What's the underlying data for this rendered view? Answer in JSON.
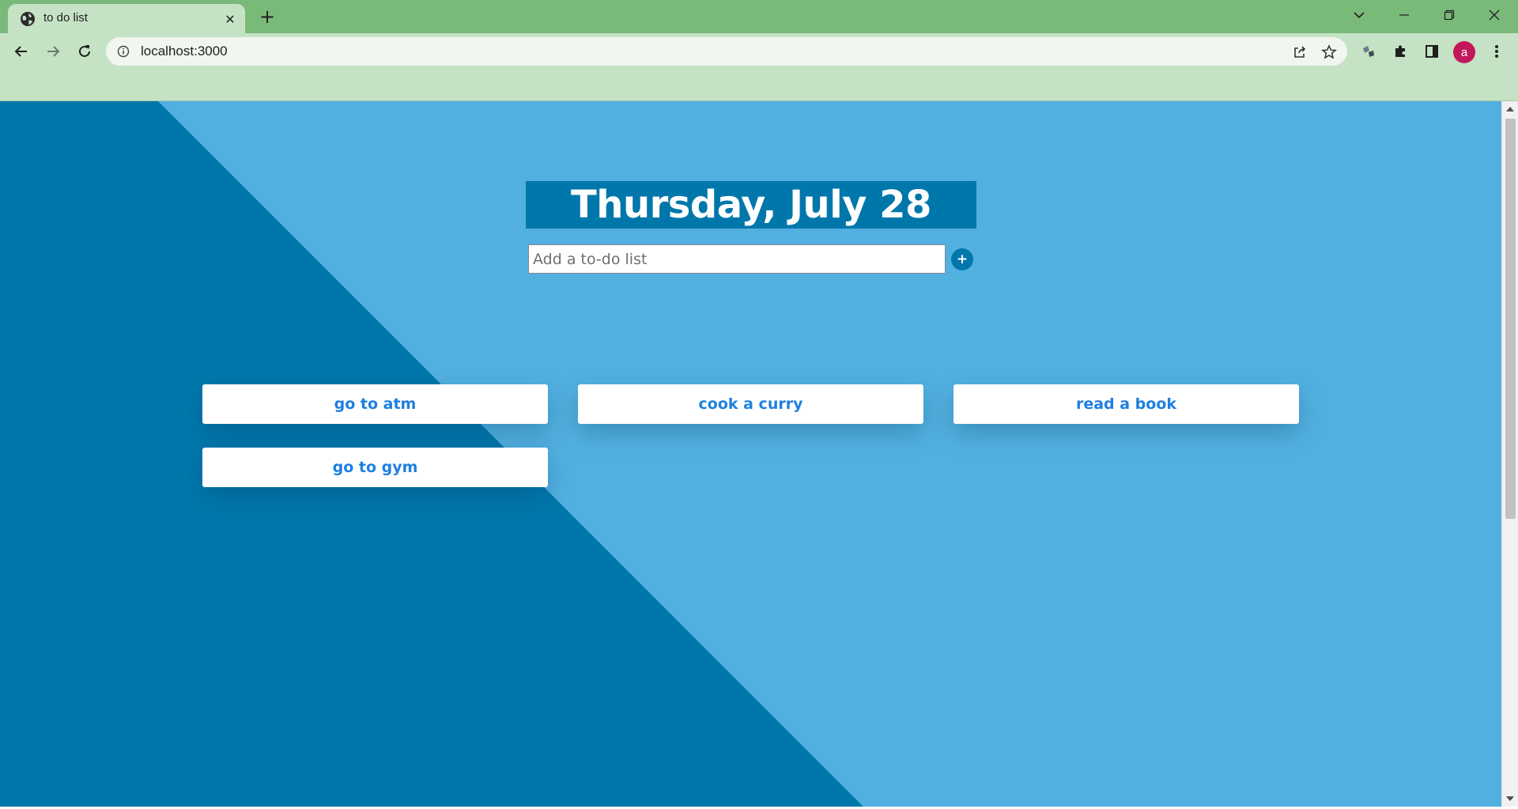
{
  "browser": {
    "tab_title": "to do list",
    "tab_close_icon": "close-icon",
    "new_tab_icon": "plus-icon",
    "url": "localhost:3000",
    "avatar_initial": "a",
    "colors": {
      "tabstrip": "#7aba79",
      "toolbar": "#c6e2c5",
      "avatar": "#c2185b"
    }
  },
  "page": {
    "date_heading": "Thursday, July 28",
    "input_placeholder": "Add a to-do list",
    "add_button_label": "+",
    "todos": [
      {
        "label": "go to atm"
      },
      {
        "label": "cook a curry"
      },
      {
        "label": "read a book"
      },
      {
        "label": "go to gym"
      }
    ],
    "colors": {
      "background_light": "#52b0e0",
      "background_dark": "#0077ab",
      "heading_bg": "#0077ab",
      "card_text": "#1e7fe0"
    }
  }
}
